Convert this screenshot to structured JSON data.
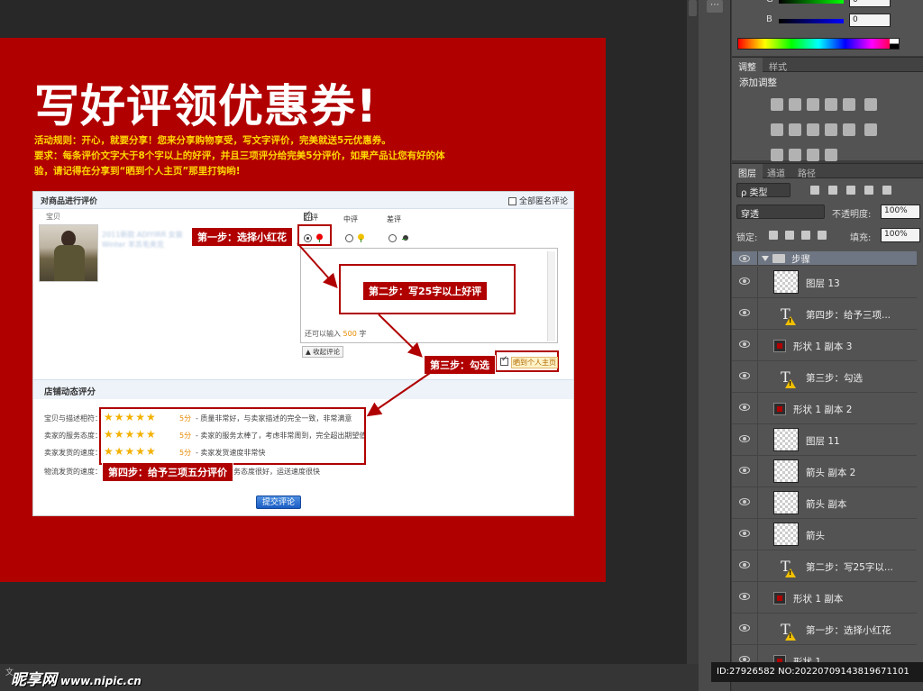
{
  "artboard": {
    "headline": "写好评领优惠券!",
    "rules_line1": "活动规则：开心，就要分享！您来分享购物享受，写文字评价，完美就送5元优惠券。",
    "rules_line2": "要求：每条评价文字大于8个字以上的好评，并且三项评分给完美5分评价，如果产品让您有好的体",
    "rules_line3": "验，请记得在分享到“晒到个人主页”那里打钩哟!"
  },
  "review_panel": {
    "header": "对商品进行评价",
    "anonymous_label": "全部匿名评论",
    "product_label": "宝贝",
    "blurred_title": "2011新款 ADIYIRR 女装 Winter 羊羔毛夹克",
    "rating_options": [
      "好评",
      "中评",
      "差评"
    ],
    "remaining_prefix": "还可以输入",
    "remaining_count": "500",
    "remaining_suffix": "字",
    "collapse_label": "收起评论",
    "share_label": "晒到个人主页",
    "store_header": "店铺动态评分",
    "scores": [
      {
        "label": "宝贝与描述相符：",
        "points": "5分",
        "desc": " - 质量非常好，与卖家描述的完全一致，非常满意"
      },
      {
        "label": "卖家的服务态度：",
        "points": "5分",
        "desc": " - 卖家的服务太棒了，考虑非常周到，完全超出期望值"
      },
      {
        "label": "卖家发货的速度：",
        "points": "5分",
        "desc": " - 卖家发货速度非常快"
      },
      {
        "label": "物流发货的速度：",
        "points": "",
        "desc": "务态度很好，运送速度很快"
      }
    ],
    "stars": "★★★★★",
    "submit_label": "提交评论"
  },
  "callouts": {
    "step1": "第一步：选择小红花",
    "step2": "第二步：写25字以上好评",
    "step3": "第三步：勾选",
    "step4": "第四步：给予三项五分评价"
  },
  "status": {
    "doc_label": "文",
    "watermark_main": "昵享网",
    "watermark_url": "www.nipic.cn",
    "image_id": "ID:27926582 NO:20220709143819671101"
  },
  "color_panel": {
    "g_label": "G",
    "b_label": "B",
    "g_value": "0",
    "b_value": "0"
  },
  "adjustments": {
    "tabs": [
      "调整",
      "样式"
    ],
    "title": "添加调整"
  },
  "layers_panel": {
    "tabs": [
      "图层",
      "通道",
      "路径"
    ],
    "filter_kind": "ρ 类型",
    "blend_mode": "穿透",
    "opacity_label": "不透明度:",
    "opacity_value": "100%",
    "lock_label": "锁定:",
    "fill_label": "填充:",
    "fill_value": "100%",
    "group_name": "步骤",
    "layers": [
      {
        "name": "图层 13",
        "kind": "raster"
      },
      {
        "name": "第四步：给予三项...",
        "kind": "text"
      },
      {
        "name": "形状 1 副本 3",
        "kind": "shape"
      },
      {
        "name": "第三步：勾选",
        "kind": "text"
      },
      {
        "name": "形状 1 副本 2",
        "kind": "shape"
      },
      {
        "name": "图层 11",
        "kind": "raster"
      },
      {
        "name": "箭头 副本 2",
        "kind": "raster"
      },
      {
        "name": "箭头 副本",
        "kind": "raster"
      },
      {
        "name": "箭头",
        "kind": "raster"
      },
      {
        "name": "第二步：写25字以...",
        "kind": "text"
      },
      {
        "name": "形状 1 副本",
        "kind": "shape"
      },
      {
        "name": "第一步：选择小红花",
        "kind": "text"
      },
      {
        "name": "形状 1",
        "kind": "shape"
      }
    ]
  },
  "colors": {
    "artboard_red": "#b00000",
    "headline_white": "#ffffff",
    "rules_yellow": "#ffd700",
    "star_gold": "#f3b100",
    "ps_panel": "#535353"
  }
}
